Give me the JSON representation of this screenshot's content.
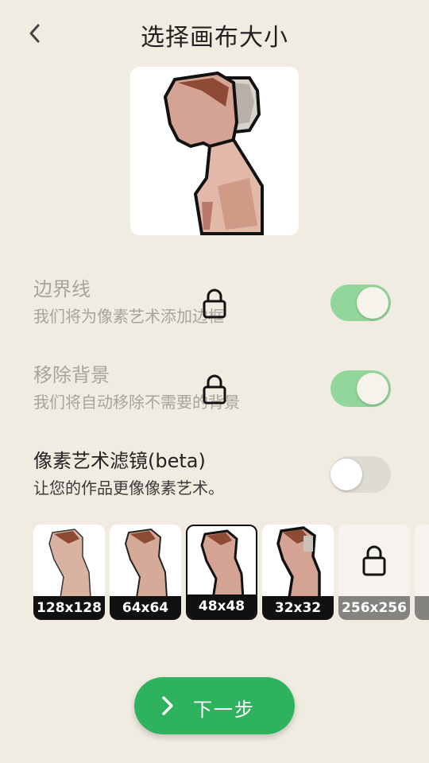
{
  "header": {
    "title": "选择画布大小",
    "back_icon": "chevron-left-icon"
  },
  "options": [
    {
      "name": "边界线",
      "desc": "我们将为像素艺术添加边框",
      "locked": true,
      "toggle": "on"
    },
    {
      "name": "移除背景",
      "desc": "我们将自动移除不需要的背景",
      "locked": true,
      "toggle": "on"
    },
    {
      "name": "像素艺术滤镜(beta)",
      "desc": "让您的作品更像像素艺术。",
      "locked": false,
      "toggle": "off"
    }
  ],
  "sizes": [
    {
      "label": "128x128",
      "selected": false,
      "locked": false
    },
    {
      "label": "64x64",
      "selected": false,
      "locked": false
    },
    {
      "label": "48x48",
      "selected": true,
      "locked": false
    },
    {
      "label": "32x32",
      "selected": false,
      "locked": false
    },
    {
      "label": "256x256",
      "selected": false,
      "locked": true
    }
  ],
  "next_button": {
    "label": "下一步"
  },
  "colors": {
    "accent": "#2fb25d",
    "toggle_on": "#93d69b",
    "background": "#f1ece2"
  }
}
